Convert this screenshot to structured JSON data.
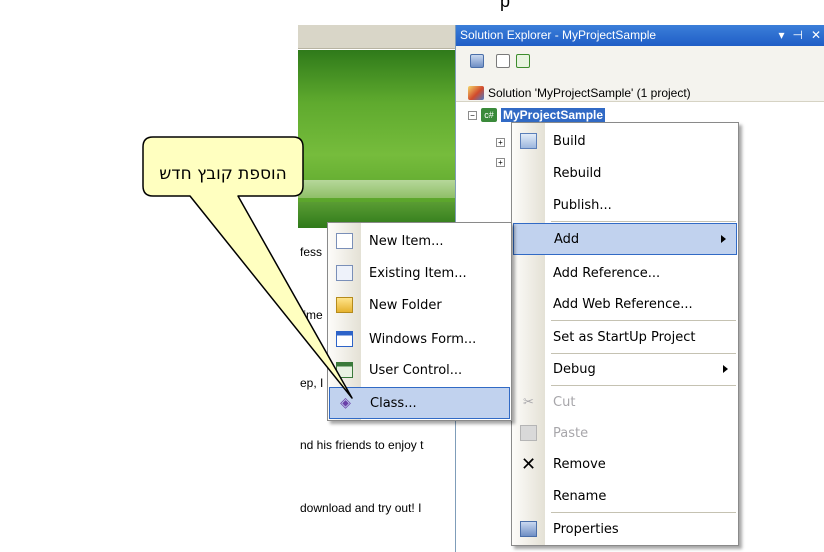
{
  "top_fragment": "p",
  "editor": {
    "text_lines": [
      "fess",
      "time",
      "ep, I",
      "nd his friends to enjoy t",
      "download and try out! I"
    ]
  },
  "solution_explorer": {
    "title": "Solution Explorer - MyProjectSample",
    "title_buttons": [
      "▾",
      "⊣",
      "✕"
    ],
    "solution_node": "Solution 'MyProjectSample' (1 project)",
    "project_node": "MyProjectSample"
  },
  "project_menu": {
    "items": [
      {
        "label": "Build",
        "icon": "build-icon"
      },
      {
        "label": "Rebuild"
      },
      {
        "label": "Publish..."
      },
      {
        "label": "Add",
        "submenu": true,
        "highlighted": true
      },
      {
        "label": "Add Reference..."
      },
      {
        "label": "Add Web Reference..."
      },
      {
        "label": "Set as StartUp Project"
      },
      {
        "label": "Debug",
        "submenu": true
      },
      {
        "label": "Cut",
        "icon": "scissors-icon",
        "disabled": true
      },
      {
        "label": "Paste",
        "icon": "paste-icon",
        "disabled": true
      },
      {
        "label": "Remove",
        "icon": "remove-x-icon"
      },
      {
        "label": "Rename"
      },
      {
        "label": "Properties",
        "icon": "properties-icon"
      }
    ]
  },
  "add_menu": {
    "items": [
      {
        "label": "New Item...",
        "icon": "new-item-icon"
      },
      {
        "label": "Existing Item...",
        "icon": "existing-item-icon"
      },
      {
        "label": "New Folder",
        "icon": "new-folder-icon"
      },
      {
        "label": "Windows Form...",
        "icon": "windows-form-icon"
      },
      {
        "label": "User Control...",
        "icon": "user-control-icon"
      },
      {
        "label": "Class...",
        "icon": "class-icon",
        "highlighted": true
      }
    ]
  },
  "callout": {
    "text": "הוספת קובץ חדש",
    "fill": "#ffffc0"
  },
  "colors": {
    "title_bar": "#2a6bd4",
    "menu_highlight": "#c1d2ee",
    "menu_highlight_border": "#316ac5",
    "project_selection": "#316ac5"
  }
}
